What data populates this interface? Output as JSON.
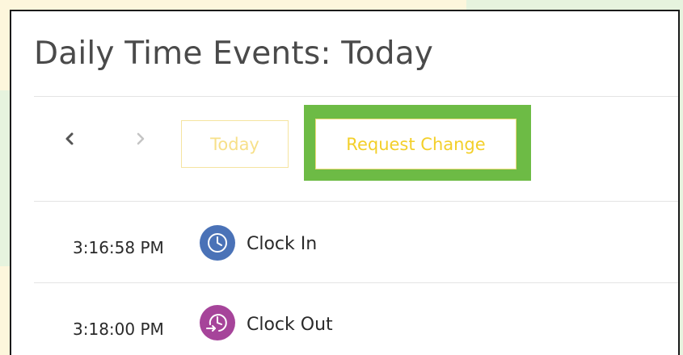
{
  "header": {
    "title": "Daily Time Events: Today"
  },
  "toolbar": {
    "prev_icon": "chevron-left-icon",
    "next_icon": "chevron-right-icon",
    "today_label": "Today",
    "request_change_label": "Request Change"
  },
  "events": [
    {
      "time": "3:16:58 PM",
      "label": "Clock In",
      "icon": "clock-icon",
      "color": "#4a72b7"
    },
    {
      "time": "3:18:00 PM",
      "label": "Clock Out",
      "icon": "clock-out-icon",
      "color": "#a6449a"
    }
  ],
  "colors": {
    "highlight": "#6dbb45",
    "accent_text": "#f3cf2a",
    "clock_in": "#4a72b7",
    "clock_out": "#a6449a"
  }
}
